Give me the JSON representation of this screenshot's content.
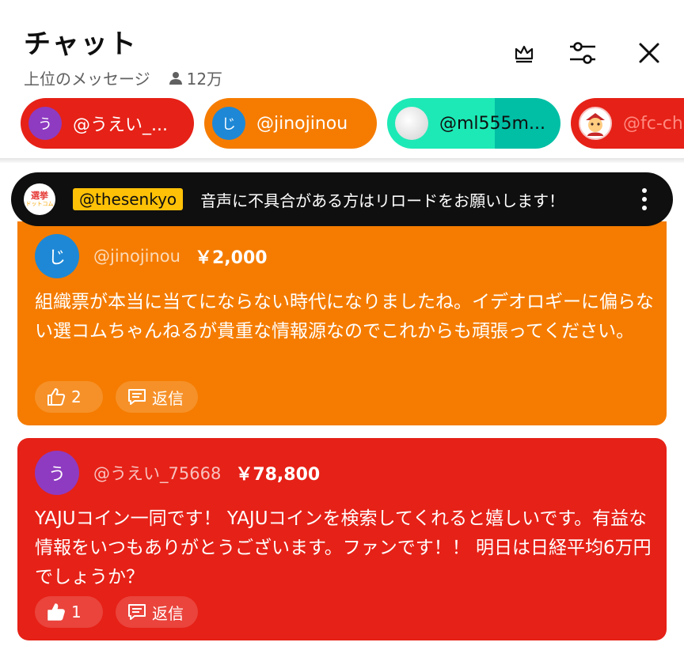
{
  "header": {
    "title": "チャット",
    "mode_label": "上位のメッセージ",
    "viewer_count": "12万"
  },
  "icons": {
    "crown": "crown-icon",
    "filter": "sliders-icon",
    "close": "close-icon",
    "viewer": "person-icon",
    "like": "thumbs-up-icon",
    "reply": "reply-icon",
    "menu": "more-vert-icon"
  },
  "pinned_chips": [
    {
      "avatar_letter": "う",
      "name": "@うえい_..."
    },
    {
      "avatar_letter": "じ",
      "name": "@jinojinou"
    },
    {
      "avatar_letter": "",
      "name": "@ml555m..."
    },
    {
      "avatar_letter": "",
      "name": "@fc-ch"
    }
  ],
  "banner": {
    "logo_line1": "選挙",
    "logo_line2": "ドットコム",
    "handle": "@thesenkyo",
    "text": "音声に不具合がある方はリロードをお願いします！"
  },
  "messages": [
    {
      "avatar_letter": "じ",
      "author": "@jinojinou",
      "amount": "￥2,000",
      "text": "組織票が本当に当てにならない時代になりましたね。イデオロギーに偏らない選コムちゃんねるが貴重な情報源なのでこれからも頑張ってください。",
      "likes": "2",
      "reply_label": "返信"
    },
    {
      "avatar_letter": "う",
      "author": "@うえい_75668",
      "amount": "￥78,800",
      "text": "YAJUコイン一同です！ YAJUコインを検索してくれると嬉しいです。有益な情報をいつもありがとうございます。ファンです！！ 明日は日経平均6万円でしょうか？",
      "likes": "1",
      "reply_label": "返信"
    }
  ],
  "colors": {
    "superchat_orange": "#f57c00",
    "superchat_red": "#e62117",
    "teal_chip": "#1de9b6",
    "banner_bg": "#0f0f0f",
    "handle_highlight": "#ffc107"
  }
}
